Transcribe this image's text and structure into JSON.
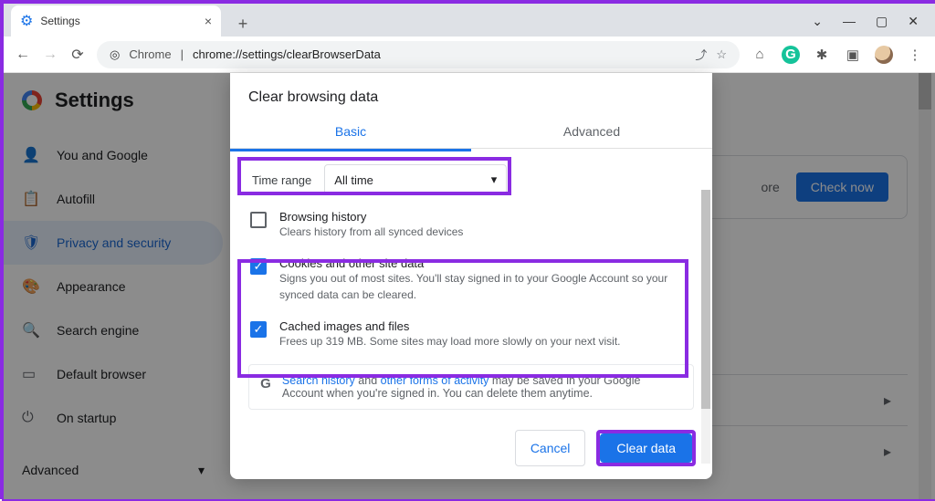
{
  "window": {
    "tab_title": "Settings",
    "new_tab_glyph": "+",
    "close_glyph": "×",
    "caret": "⌄",
    "min": "—",
    "max": "▢",
    "close": "✕"
  },
  "address": {
    "scheme": "Chrome",
    "sep": "|",
    "url": "chrome://settings/clearBrowserData"
  },
  "toolbar_icons": {
    "share": "⇪",
    "star": "☆",
    "cast": "⌬",
    "grammarly": "G",
    "puzzle": "✦",
    "reader": "▣",
    "menu": "⋮"
  },
  "settings": {
    "title": "Settings",
    "items": [
      {
        "icon": "👤",
        "label": "You and Google"
      },
      {
        "icon": "📋",
        "label": "Autofill"
      },
      {
        "icon": "🛡",
        "label": "Privacy and security"
      },
      {
        "icon": "🎨",
        "label": "Appearance"
      },
      {
        "icon": "🔍",
        "label": "Search engine"
      },
      {
        "icon": "▭",
        "label": "Default browser"
      },
      {
        "icon": "⏻",
        "label": "On startup"
      }
    ],
    "advanced": "Advanced",
    "safety_more": "ore",
    "check_now": "Check now"
  },
  "dialog": {
    "title": "Clear browsing data",
    "tabs": {
      "basic": "Basic",
      "advanced": "Advanced"
    },
    "time_label": "Time range",
    "time_value": "All time",
    "options": [
      {
        "title": "Browsing history",
        "desc": "Clears history from all synced devices",
        "checked": false
      },
      {
        "title": "Cookies and other site data",
        "desc": "Signs you out of most sites. You'll stay signed in to your Google Account so your synced data can be cleared.",
        "checked": true
      },
      {
        "title": "Cached images and files",
        "desc": "Frees up 319 MB. Some sites may load more slowly on your next visit.",
        "checked": true
      }
    ],
    "info_pre": "Search history",
    "info_mid": " and ",
    "info_link2": "other forms of activity",
    "info_post": " may be saved in your Google Account when you're signed in. You can delete them anytime.",
    "cancel": "Cancel",
    "clear": "Clear data"
  }
}
